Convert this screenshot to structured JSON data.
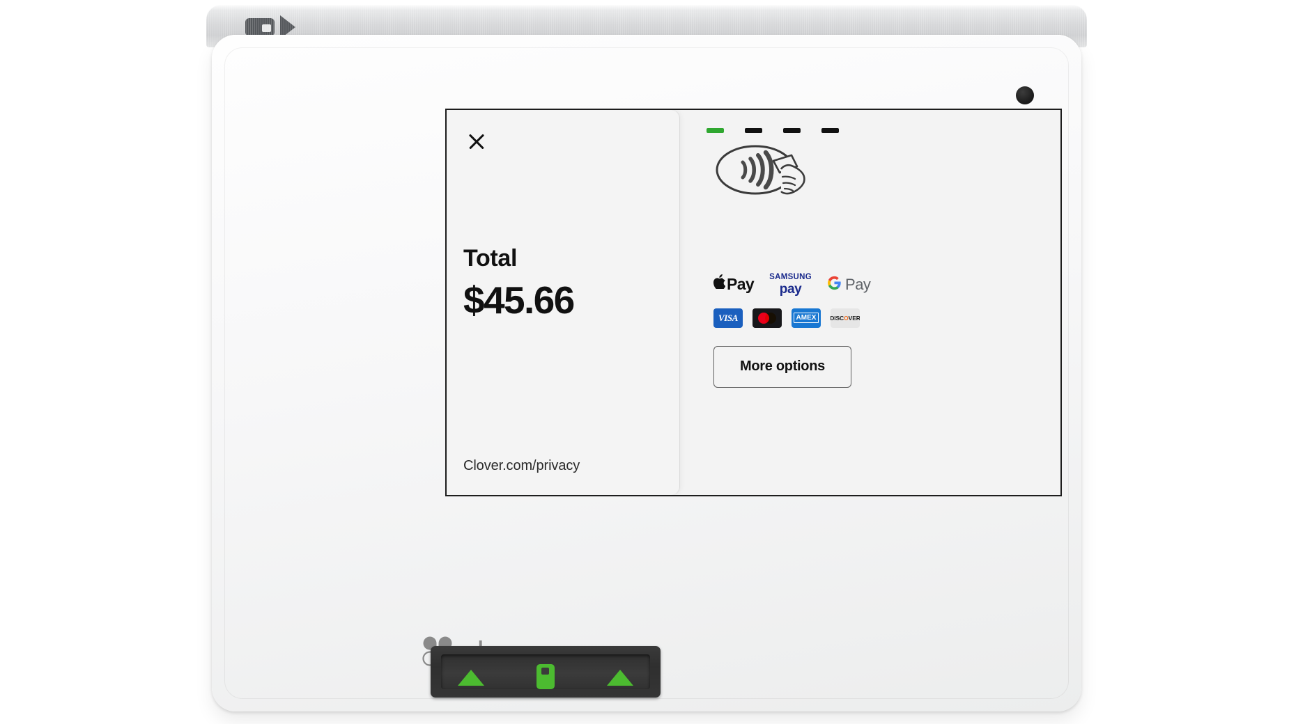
{
  "device": {
    "brand": "clover",
    "top_strip": {
      "chip_icon": "chip-card-icon",
      "arrow_icon": "insert-direction-arrow-icon"
    },
    "camera": "front-camera-dot",
    "card_reader": {
      "left_arrow": "insert-arrow-left",
      "right_arrow": "insert-arrow-right",
      "card_icon": "green-chip-card-icon"
    }
  },
  "screen": {
    "left_panel": {
      "close_icon": "close-x-icon",
      "total_label": "Total",
      "total_amount": "$45.66",
      "privacy_link": "Clover.com/privacy"
    },
    "right_panel": {
      "progress": {
        "steps": 4,
        "active_index": 0,
        "active_color": "#2fa730",
        "inactive_color": "#111111"
      },
      "contactless_icon": "contactless-tap-card-icon",
      "wallets": [
        {
          "name": "apple-pay",
          "mark": "",
          "label": "Pay"
        },
        {
          "name": "samsung-pay",
          "line1": "SAMSUNG",
          "line2": "pay"
        },
        {
          "name": "google-pay",
          "mark": "G",
          "label": "Pay"
        }
      ],
      "cards": [
        {
          "name": "visa",
          "label": "VISA"
        },
        {
          "name": "mastercard",
          "label": ""
        },
        {
          "name": "amex",
          "label": "AMEX"
        },
        {
          "name": "discover",
          "pre": "DISC",
          "dot": "O",
          "post": "VER"
        }
      ],
      "more_options_label": "More options"
    }
  },
  "colors": {
    "accent_green": "#4cbb30",
    "progress_green": "#2fa730",
    "visa_blue": "#1a5fbe",
    "amex_blue": "#1877d2",
    "mc_red": "#eb001b",
    "mc_orange": "#f79e1b",
    "discover_orange": "#f26e21",
    "samsung_blue": "#1a2a8c",
    "screen_bg": "#f3f3f3"
  }
}
